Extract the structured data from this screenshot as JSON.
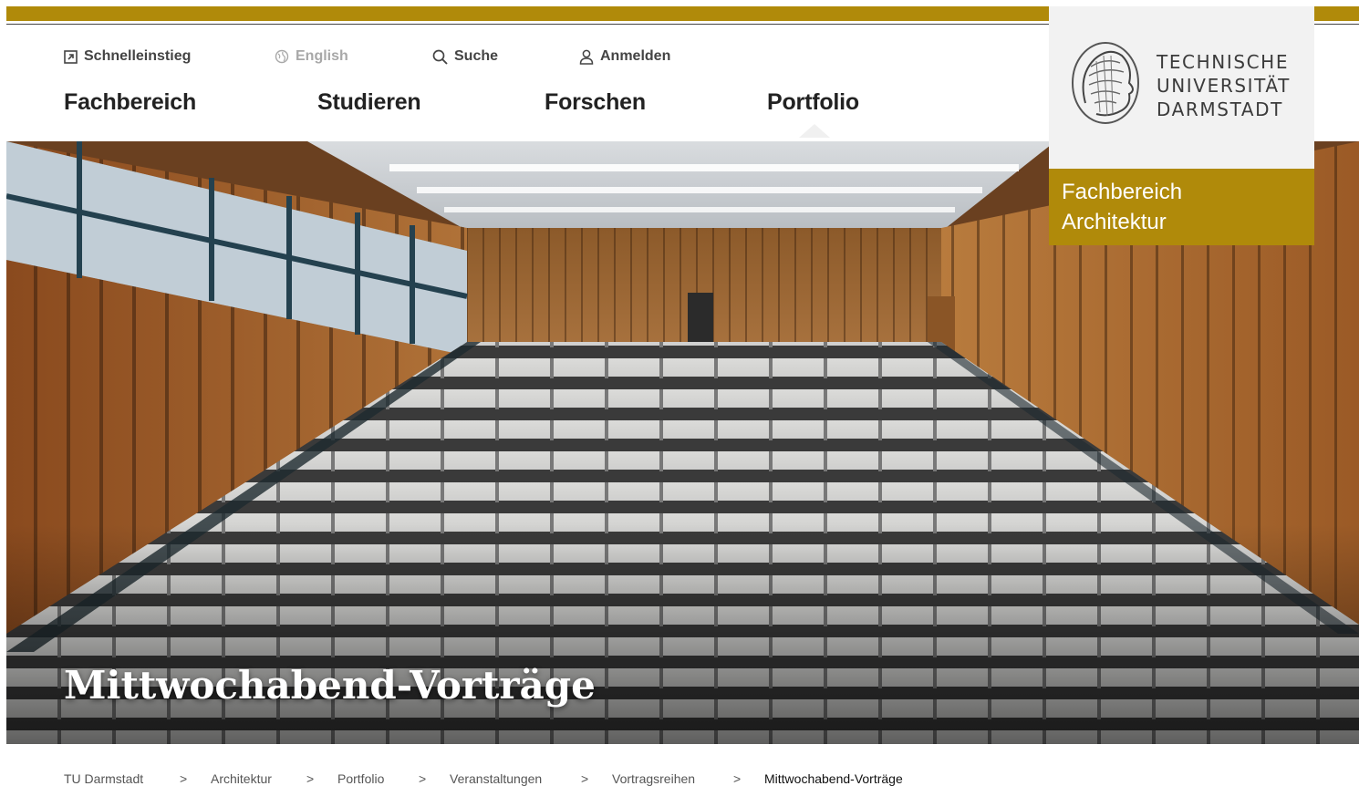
{
  "utility_nav": {
    "quick_access": "Schnelleinstieg",
    "language": "English",
    "search": "Suche",
    "login": "Anmelden"
  },
  "main_nav": {
    "items": [
      "Fachbereich",
      "Studieren",
      "Forschen",
      "Portfolio"
    ],
    "active": "Portfolio"
  },
  "logo": {
    "lines": [
      "TECHNISCHE",
      "UNIVERSITÄT",
      "DARMSTADT"
    ]
  },
  "department": {
    "line1": "Fachbereich",
    "line2": "Architektur"
  },
  "hero": {
    "title": "Mittwochabend-Vorträge"
  },
  "breadcrumb": {
    "items": [
      "TU Darmstadt",
      "Architektur",
      "Portfolio",
      "Veranstaltungen",
      "Vortragsreihen",
      "Mittwochabend-Vorträge"
    ],
    "separator": ">"
  },
  "colors": {
    "accent": "#b08a0a",
    "logo_bg": "#f2f2f2"
  }
}
